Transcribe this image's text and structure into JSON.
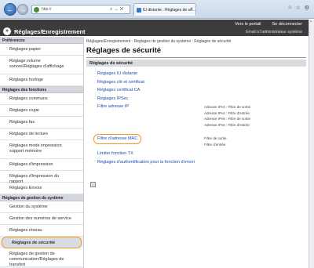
{
  "browser": {
    "address": "http://",
    "tab_title": "IU distante : Réglages de sé...",
    "tab_close": "×",
    "addr_tools": "⌕ → ✕",
    "back_glyph": "←",
    "fwd_glyph": "→",
    "win_icons": [
      "⌂",
      "☆",
      "⚙"
    ]
  },
  "header": {
    "title": "Réglages/Enregistrement",
    "portal_link": "Vers le portail",
    "logout_link": "Se déconnecter",
    "email_link": "Email à l'administrateur système",
    "logo_glyph": "»"
  },
  "sidebar": {
    "sections": [
      {
        "title": "Préférences",
        "items": [
          "Réglages papier",
          "Réglage volume sonore/Réglages d'affichage",
          "Réglages horloge"
        ]
      },
      {
        "title": "Réglages des fonctions",
        "items": [
          "Réglages communs",
          "Réglages copie",
          "Réglages fax",
          "Réglages de lecture",
          "Réglages mode impression support mémoire",
          "Réglages d'impression",
          "Réglages d'impression du rapport",
          "Réglages Envois"
        ]
      },
      {
        "title": "Réglages de gestion du système",
        "items": [
          "Gestion du système",
          "Gestion des numéros de service",
          "Réglages réseau",
          "Réglages de sécurité",
          "Réglages de gestion de communication/Réglages de transfert"
        ]
      }
    ]
  },
  "main": {
    "breadcrumb": "Réglages/Enregistrement : Réglages de gestion du système : Réglages de sécurité",
    "title": "Réglages de sécurité",
    "section_title": "Réglages de sécurité",
    "links": {
      "iu": "Réglages IU distante",
      "key": "Réglages clé et certificat",
      "ca": "Réglages certificat CA",
      "ipsec": "Réglages IPSec",
      "ipfilter": "Filtre adresse IP",
      "macfilter": "Filtre d'adresse MAC",
      "tx": "Limiter fonction TX",
      "auth": "Réglages d'authentification pour la fonction d'envoi"
    },
    "ip_status": [
      "Adresse IPv4 : Filtre de sortie",
      "Adresse IPv4 : Filtre d'entrée",
      "Adresse IPv6 : Filtre de sortie",
      "Adresse IPv6 : Filtre d'entrée"
    ],
    "mac_status": [
      "Filtre de sortie",
      "Filtre d'entrée"
    ]
  }
}
